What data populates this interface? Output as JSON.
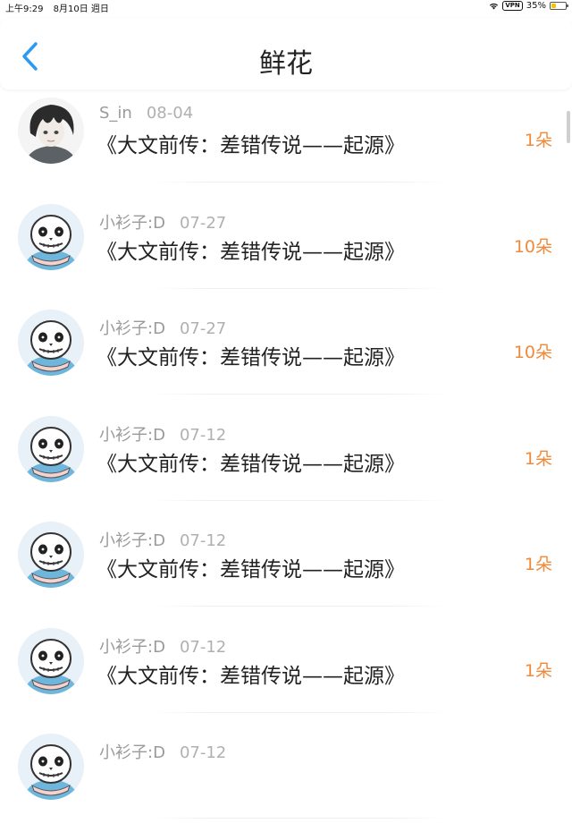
{
  "status_bar": {
    "time": "上午9:29",
    "date": "8月10日 週日",
    "vpn": "VPN",
    "battery": "35%",
    "battery_level": 0.35
  },
  "nav": {
    "title": "鲜花",
    "back_icon": "chevron-left-icon",
    "accent": "#2b9af3"
  },
  "entries": [
    {
      "user": "S_in",
      "date": "08-04",
      "title": "《大文前传：差错传说——起源》",
      "count": "1朵",
      "avatar": "dark-hair-avatar"
    },
    {
      "user": "小衫子:D",
      "date": "07-27",
      "title": "《大文前传：差错传说——起源》",
      "count": "10朵",
      "avatar": "skeleton-avatar"
    },
    {
      "user": "小衫子:D",
      "date": "07-27",
      "title": "《大文前传：差错传说——起源》",
      "count": "10朵",
      "avatar": "skeleton-avatar"
    },
    {
      "user": "小衫子:D",
      "date": "07-12",
      "title": "《大文前传：差错传说——起源》",
      "count": "1朵",
      "avatar": "skeleton-avatar"
    },
    {
      "user": "小衫子:D",
      "date": "07-12",
      "title": "《大文前传：差错传说——起源》",
      "count": "1朵",
      "avatar": "skeleton-avatar"
    },
    {
      "user": "小衫子:D",
      "date": "07-12",
      "title": "《大文前传：差错传说——起源》",
      "count": "1朵",
      "avatar": "skeleton-avatar"
    },
    {
      "user": "小衫子:D",
      "date": "07-12",
      "title": "",
      "count": "",
      "avatar": "skeleton-avatar"
    }
  ],
  "colors": {
    "count": "#f08a3a",
    "meta": "#9a9a9a"
  }
}
